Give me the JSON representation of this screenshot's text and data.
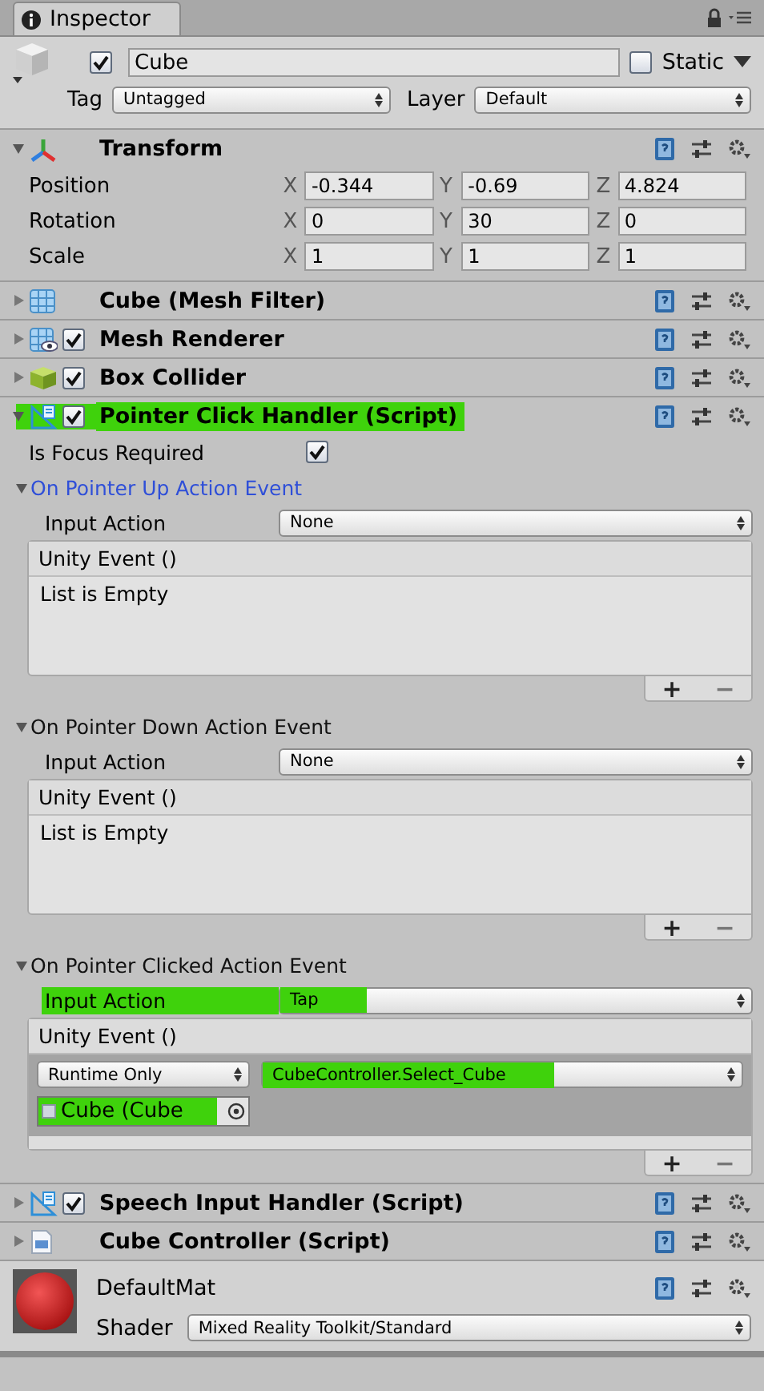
{
  "tab": {
    "title": "Inspector"
  },
  "object": {
    "active": true,
    "name": "Cube",
    "static_label": "Static",
    "static": false,
    "tag_label": "Tag",
    "tag": "Untagged",
    "layer_label": "Layer",
    "layer": "Default"
  },
  "components": [
    {
      "kind": "transform",
      "title": "Transform",
      "expanded": true,
      "rows": [
        {
          "label": "Position",
          "fields": [
            {
              "axis": "X",
              "value": "-0.344"
            },
            {
              "axis": "Y",
              "value": "-0.69"
            },
            {
              "axis": "Z",
              "value": "4.824"
            }
          ]
        },
        {
          "label": "Rotation",
          "fields": [
            {
              "axis": "X",
              "value": "0"
            },
            {
              "axis": "Y",
              "value": "30"
            },
            {
              "axis": "Z",
              "value": "0"
            }
          ]
        },
        {
          "label": "Scale",
          "fields": [
            {
              "axis": "X",
              "value": "1"
            },
            {
              "axis": "Y",
              "value": "1"
            },
            {
              "axis": "Z",
              "value": "1"
            }
          ]
        }
      ]
    },
    {
      "kind": "meshfilter",
      "title": "Cube (Mesh Filter)",
      "expanded": false
    },
    {
      "kind": "meshrenderer",
      "title": "Mesh Renderer",
      "expanded": false,
      "enabled": true
    },
    {
      "kind": "boxcollider",
      "title": "Box Collider",
      "expanded": false,
      "enabled": true
    },
    {
      "kind": "script",
      "title": "Pointer Click Handler (Script)",
      "expanded": true,
      "enabled": true,
      "highlighted": true,
      "properties": [
        {
          "label": "Is Focus Required",
          "checked": true
        }
      ],
      "events": [
        {
          "title": "On Pointer Up Action Event",
          "expanded": true,
          "selected": true,
          "input_label": "Input Action",
          "input_value": "None",
          "highlighted": false,
          "list_title": "Unity Event ()",
          "empty_text": "List is Empty",
          "add_label": "+",
          "remove_label": "−"
        },
        {
          "title": "On Pointer Down Action Event",
          "expanded": true,
          "selected": false,
          "input_label": "Input Action",
          "input_value": "None",
          "highlighted": false,
          "list_title": "Unity Event ()",
          "empty_text": "List is Empty",
          "add_label": "+",
          "remove_label": "−"
        },
        {
          "title": "On Pointer Clicked Action Event",
          "expanded": true,
          "selected": false,
          "input_label": "Input Action",
          "input_value": "Tap",
          "highlighted": true,
          "list_title": "Unity Event ()",
          "listeners": [
            {
              "mode": "Runtime Only",
              "function": "CubeController.Select_Cube",
              "function_highlighted": true,
              "target": "Cube (Cube",
              "target_highlighted": true
            }
          ],
          "add_label": "+",
          "remove_label": "−"
        }
      ]
    },
    {
      "kind": "script",
      "title": "Speech Input Handler (Script)",
      "expanded": false,
      "enabled": true
    },
    {
      "kind": "csharp",
      "title": "Cube Controller (Script)",
      "expanded": false
    }
  ],
  "material": {
    "name": "DefaultMat",
    "shader_label": "Shader",
    "shader": "Mixed Reality Toolkit/Standard"
  }
}
